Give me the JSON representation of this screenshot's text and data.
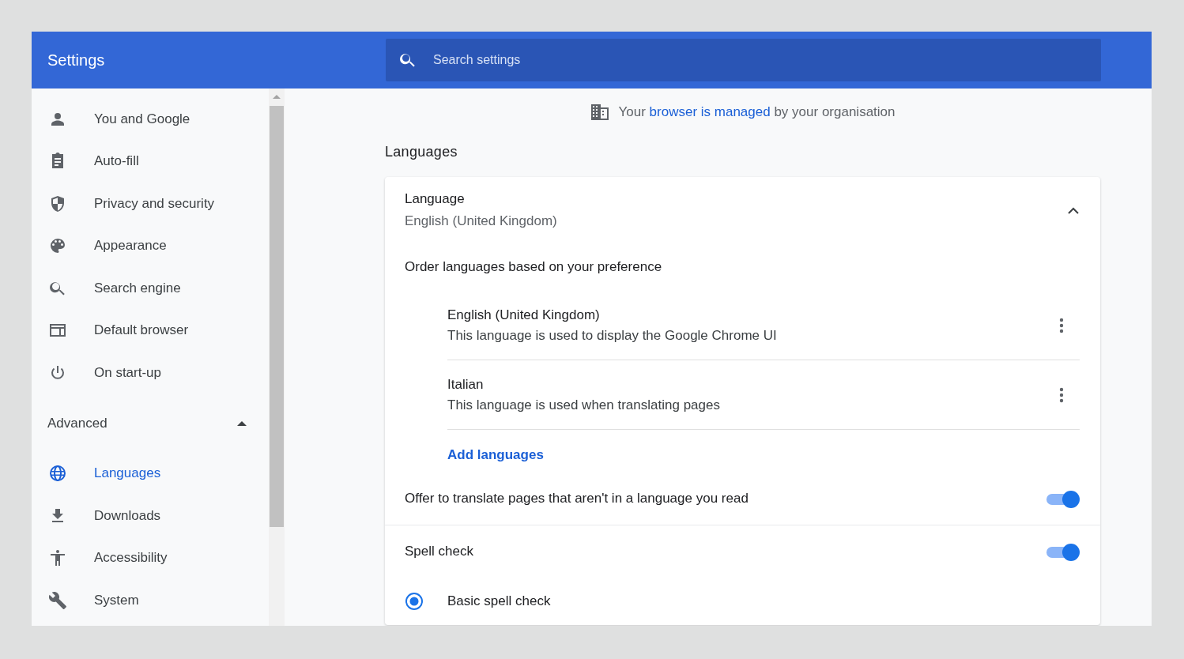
{
  "header": {
    "title": "Settings",
    "search": {
      "placeholder": "Search settings"
    }
  },
  "sidebar": {
    "items": [
      {
        "label": "You and Google",
        "selected": false
      },
      {
        "label": "Auto-fill",
        "selected": false
      },
      {
        "label": "Privacy and security",
        "selected": false
      },
      {
        "label": "Appearance",
        "selected": false
      },
      {
        "label": "Search engine",
        "selected": false
      },
      {
        "label": "Default browser",
        "selected": false
      },
      {
        "label": "On start-up",
        "selected": false
      }
    ],
    "advanced": {
      "label": "Advanced",
      "expanded": true,
      "items": [
        {
          "label": "Languages",
          "selected": true
        },
        {
          "label": "Downloads",
          "selected": false
        },
        {
          "label": "Accessibility",
          "selected": false
        },
        {
          "label": "System",
          "selected": false
        }
      ]
    }
  },
  "managed_notice": {
    "prefix": "Your",
    "link": "browser is managed",
    "suffix": "by your organisation"
  },
  "section_title": "Languages",
  "language_panel": {
    "title": "Language",
    "value": "English (United Kingdom)",
    "expanded": true,
    "order_label": "Order languages based on your preference",
    "languages": [
      {
        "name": "English (United Kingdom)",
        "description": "This language is used to display the Google Chrome UI"
      },
      {
        "name": "Italian",
        "description": "This language is used when translating pages"
      }
    ],
    "add_link": "Add languages"
  },
  "translate_toggle": {
    "label": "Offer to translate pages that aren't in a language you read",
    "on": true
  },
  "spell_check": {
    "label": "Spell check",
    "on": true,
    "options": [
      {
        "label": "Basic spell check",
        "selected": true
      }
    ]
  }
}
